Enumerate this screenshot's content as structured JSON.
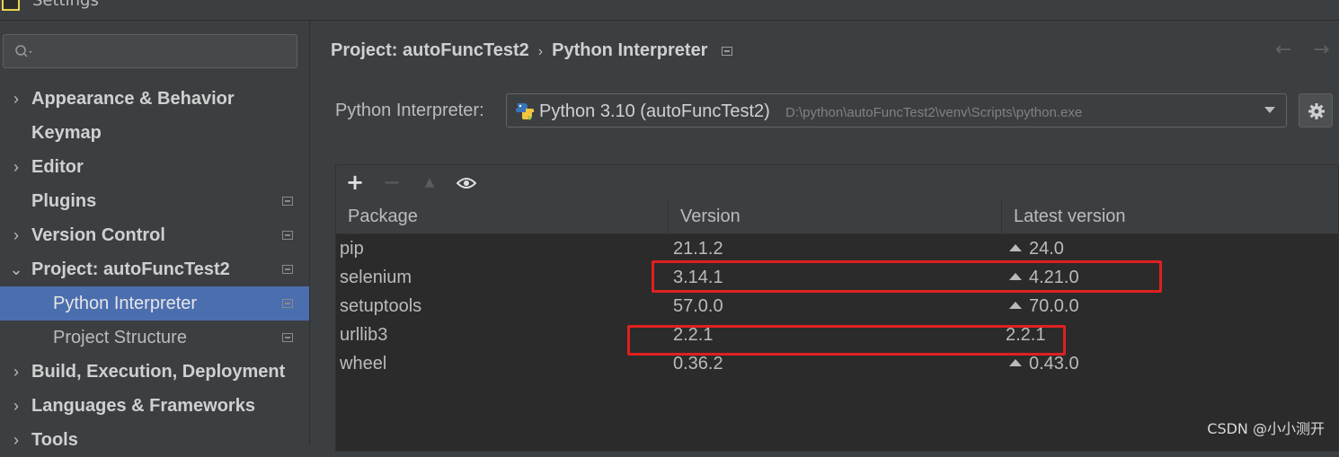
{
  "window": {
    "title": "Settings"
  },
  "search": {
    "placeholder": ""
  },
  "sidebar": {
    "items": [
      {
        "label": "Appearance & Behavior",
        "arrow": "›"
      },
      {
        "label": "Keymap",
        "arrow": ""
      },
      {
        "label": "Editor",
        "arrow": "›"
      },
      {
        "label": "Plugins",
        "arrow": ""
      },
      {
        "label": "Version Control",
        "arrow": "›"
      },
      {
        "label": "Project: autoFuncTest2",
        "arrow": "⌄"
      },
      {
        "label": "Python Interpreter",
        "arrow": ""
      },
      {
        "label": "Project Structure",
        "arrow": ""
      },
      {
        "label": "Build, Execution, Deployment",
        "arrow": "›"
      },
      {
        "label": "Languages & Frameworks",
        "arrow": "›"
      },
      {
        "label": "Tools",
        "arrow": "›"
      }
    ]
  },
  "breadcrumb": {
    "project": "Project: autoFuncTest2",
    "separator": "›",
    "page": "Python Interpreter"
  },
  "nav": {
    "back": "←",
    "forward": "→"
  },
  "interpreter": {
    "label": "Python Interpreter:",
    "name": "Python 3.10 (autoFuncTest2)",
    "path": "D:\\python\\autoFuncTest2\\venv\\Scripts\\python.exe"
  },
  "toolbar": {
    "add": "+",
    "remove": "−",
    "upgrade": "▲",
    "show": "👁"
  },
  "table": {
    "headers": [
      "Package",
      "Version",
      "Latest version"
    ],
    "rows": [
      {
        "package": "pip",
        "version": "21.1.2",
        "latest": "24.0",
        "upgrade": true
      },
      {
        "package": "selenium",
        "version": "3.14.1",
        "latest": "4.21.0",
        "upgrade": true
      },
      {
        "package": "setuptools",
        "version": "57.0.0",
        "latest": "70.0.0",
        "upgrade": true
      },
      {
        "package": "urllib3",
        "version": "2.2.1",
        "latest": "2.2.1",
        "upgrade": false
      },
      {
        "package": "wheel",
        "version": "0.36.2",
        "latest": "0.43.0",
        "upgrade": true
      }
    ]
  },
  "watermark": "CSDN @小小测开",
  "colors": {
    "background": "#3c3f41",
    "selection": "#4b6eaf",
    "table_bg": "#2b2b2b",
    "highlight": "#e02020"
  }
}
